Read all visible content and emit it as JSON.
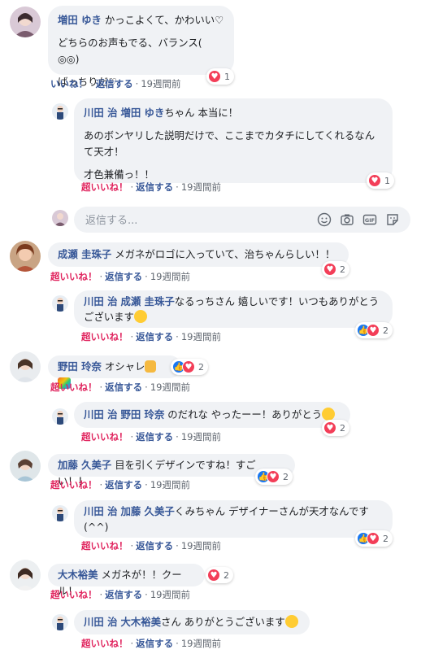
{
  "reply_placeholder": "返信する...",
  "like_label": "いいね！",
  "super_like_label": "超いいね！",
  "reply_label": "返信する",
  "dot": "·",
  "time_19w": "19週間前",
  "comments": [
    {
      "author": "増田 ゆき",
      "lines": [
        "かっこよくて、かわいい♡",
        "どちらのお声もでる、バランス( ◎◎)",
        "ばっちりだ♡"
      ],
      "reaction_count": "1"
    },
    {
      "author": "川田 治",
      "tag": "増田 ゆき",
      "lines_first_suffix": "ちゃん 本当に！",
      "lines": [
        "あのボンヤリした説明だけで、ここまでカタチにしてくれるなんて天才！",
        "才色兼備っ！！"
      ],
      "reaction_count": "1"
    },
    {
      "author": "成瀬 圭珠子",
      "text": "メガネがロゴに入っていて、治ちゃんらしい！！",
      "reaction_count": "2"
    },
    {
      "author": "川田 治",
      "tag": "成瀬 圭珠子",
      "text": "なるっちさん 嬉しいです！いつもありがとうございます",
      "reaction_count": "2"
    },
    {
      "author": "野田 玲奈",
      "text": "オシャレ",
      "reaction_count": "2"
    },
    {
      "author": "川田 治",
      "tag": "野田 玲奈",
      "text": "のだれな やったーー！ありがとう",
      "reaction_count": "2"
    },
    {
      "author": "加藤 久美子",
      "text": "目を引くデザインですね！すごい！！",
      "reaction_count": "2"
    },
    {
      "author": "川田 治",
      "tag": "加藤 久美子",
      "text": "くみちゃん デザイナーさんが天才なんです(^^)",
      "reaction_count": "2"
    },
    {
      "author": "大木裕美",
      "text": "メガネが！！クール！",
      "reaction_count": "2"
    },
    {
      "author": "川田 治",
      "tag": "大木裕美",
      "text": "さん ありがとうございます",
      "reaction_count": ""
    }
  ],
  "colors": {
    "link": "#385898",
    "super_like": "#e0245e",
    "bubble": "#f0f2f5",
    "love": "#f33e58",
    "like": "#1877f2"
  },
  "icons": [
    "heart-icon",
    "thumbs-up-icon",
    "emoji-icon",
    "camera-icon",
    "gif-icon",
    "sticker-icon"
  ]
}
